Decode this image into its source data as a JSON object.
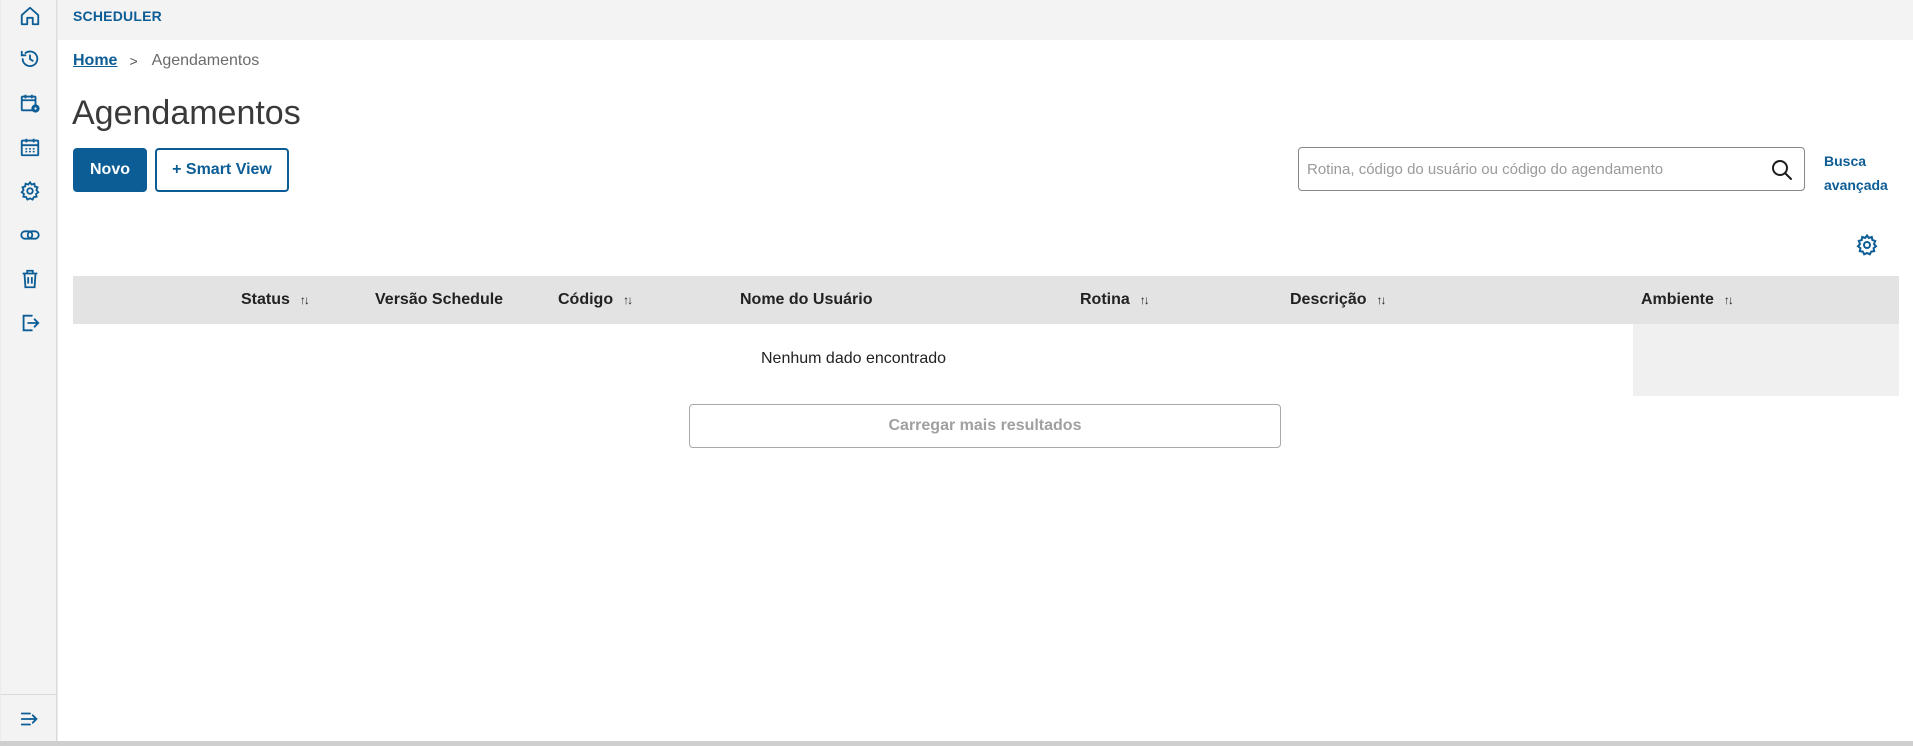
{
  "app": {
    "name": "SCHEDULER"
  },
  "sidebar": {
    "items": [
      {
        "icon": "home-icon"
      },
      {
        "icon": "history-icon"
      },
      {
        "icon": "calendar-settings-icon"
      },
      {
        "icon": "calendar-icon"
      },
      {
        "icon": "gear-icon"
      },
      {
        "icon": "link-icon"
      },
      {
        "icon": "trash-icon"
      },
      {
        "icon": "logout-icon"
      }
    ],
    "collapse_icon": "expand-menu-icon"
  },
  "breadcrumb": {
    "home": "Home",
    "separator": ">",
    "current": "Agendamentos"
  },
  "page": {
    "title": "Agendamentos"
  },
  "actions": {
    "new_label": "Novo",
    "smart_view_label": "+ Smart View"
  },
  "search": {
    "placeholder": "Rotina, código do usuário ou código do agendamento",
    "value": "",
    "advanced_label": "Busca avançada"
  },
  "table": {
    "columns": [
      {
        "label": "Status",
        "sortable": true
      },
      {
        "label": "Versão Schedule",
        "sortable": false
      },
      {
        "label": "Código",
        "sortable": true
      },
      {
        "label": "Nome do Usuário",
        "sortable": false
      },
      {
        "label": "Rotina",
        "sortable": true
      },
      {
        "label": "Descrição",
        "sortable": true
      },
      {
        "label": "Ambiente",
        "sortable": true
      }
    ],
    "sort_glyph": "↑↓",
    "empty_message": "Nenhum dado encontrado",
    "load_more_label": "Carregar mais resultados"
  },
  "colors": {
    "primary": "#0c5d95",
    "header_bg": "#e3e3e3",
    "app_bg": "#f3f3f3"
  }
}
